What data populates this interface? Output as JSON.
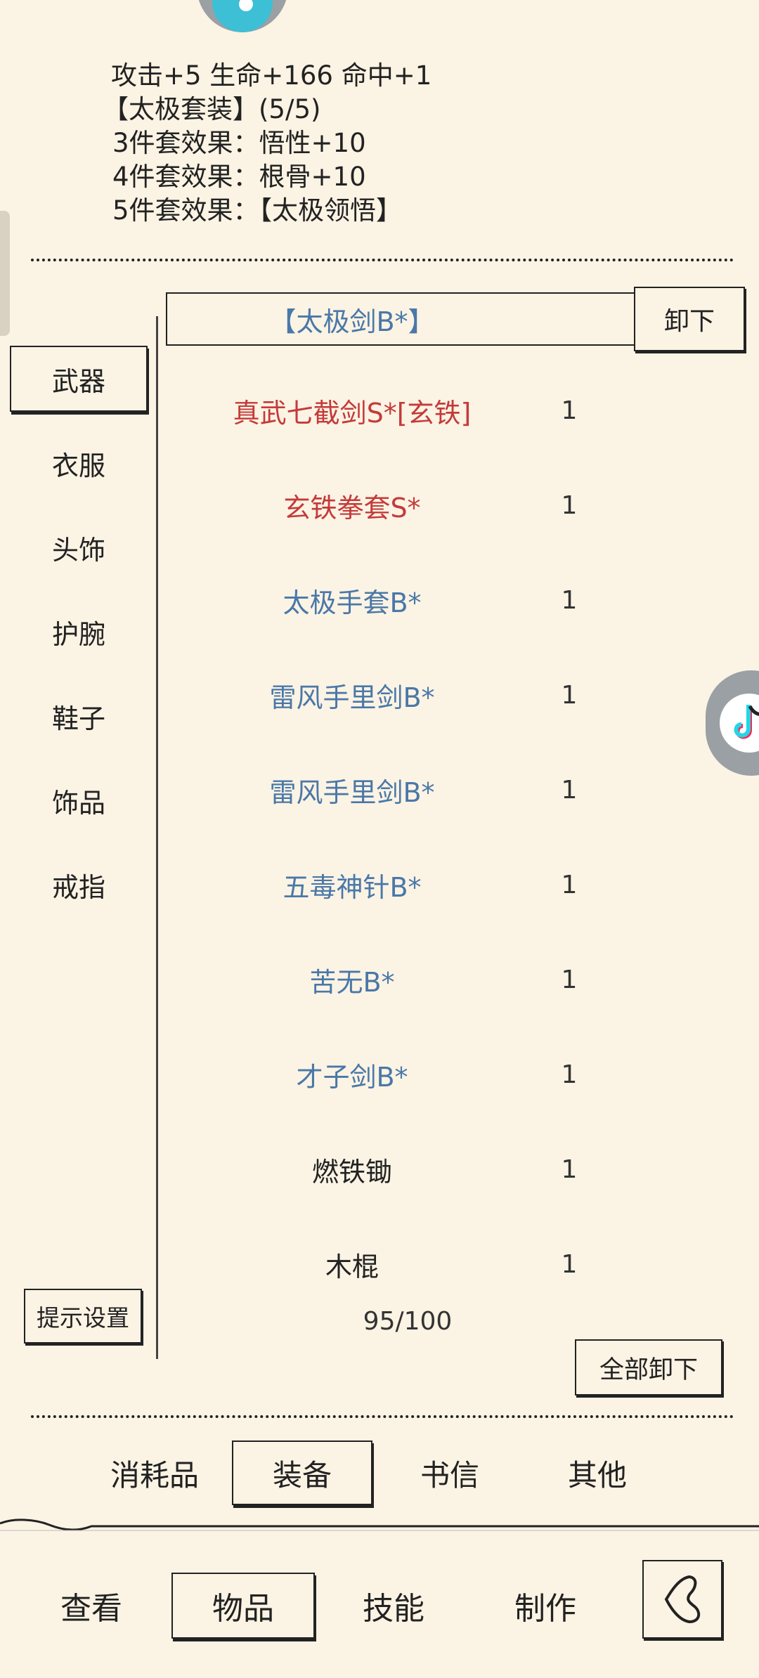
{
  "set_info": {
    "line1": "攻击+5 生命+166 命中+1",
    "set_name": "【太极套装】(5/5)",
    "effects": [
      "3件套效果：悟性+10",
      "4件套效果：根骨+10",
      "5件套效果：【太极领悟】"
    ]
  },
  "equipped": {
    "name": "【太极剑B*】",
    "unequip_label": "卸下"
  },
  "categories": [
    {
      "label": "武器"
    },
    {
      "label": "衣服"
    },
    {
      "label": "头饰"
    },
    {
      "label": "护腕"
    },
    {
      "label": "鞋子"
    },
    {
      "label": "饰品"
    },
    {
      "label": "戒指"
    }
  ],
  "items": [
    {
      "name": "真武七截剑S*[玄铁]",
      "qty": "1",
      "color": "#c43a3a"
    },
    {
      "name": "玄铁拳套S*",
      "qty": "1",
      "color": "#c43a3a"
    },
    {
      "name": "太极手套B*",
      "qty": "1",
      "color": "#4a78a8"
    },
    {
      "name": "雷风手里剑B*",
      "qty": "1",
      "color": "#4a78a8"
    },
    {
      "name": "雷风手里剑B*",
      "qty": "1",
      "color": "#4a78a8"
    },
    {
      "name": "五毒神针B*",
      "qty": "1",
      "color": "#4a78a8"
    },
    {
      "name": "苦无B*",
      "qty": "1",
      "color": "#4a78a8"
    },
    {
      "name": "才子剑B*",
      "qty": "1",
      "color": "#4a78a8"
    },
    {
      "name": "燃铁锄",
      "qty": "1",
      "color": "#222222"
    },
    {
      "name": "木棍",
      "qty": "1",
      "color": "#222222"
    }
  ],
  "hint_button": "提示设置",
  "capacity": "95/100",
  "unequip_all": "全部卸下",
  "subtabs": [
    {
      "label": "消耗品"
    },
    {
      "label": "装备"
    },
    {
      "label": "书信"
    },
    {
      "label": "其他"
    }
  ],
  "nav": [
    {
      "label": "查看"
    },
    {
      "label": "物品"
    },
    {
      "label": "技能"
    },
    {
      "label": "制作"
    }
  ],
  "icons": {
    "back": "back-arrow-icon",
    "floating_widget": "tiktok-icon"
  }
}
